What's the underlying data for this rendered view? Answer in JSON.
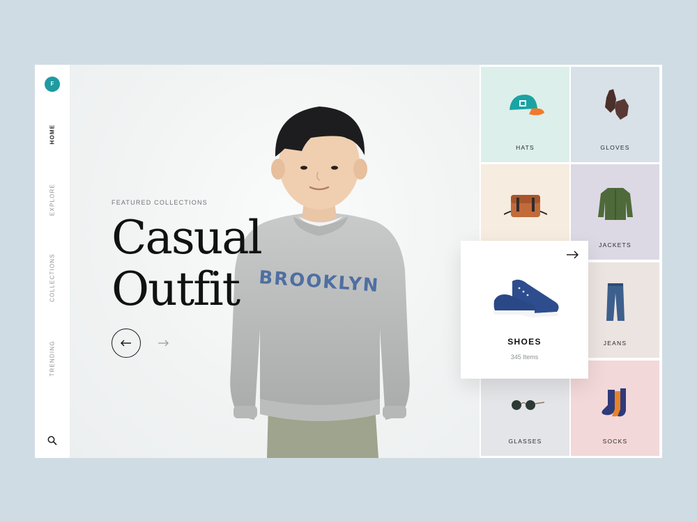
{
  "sidebar": {
    "logo_letter": "F",
    "nav": [
      {
        "label": "HOME",
        "active": true
      },
      {
        "label": "EXPLORE",
        "active": false
      },
      {
        "label": "COLLECTIONS",
        "active": false
      },
      {
        "label": "TRENDING",
        "active": false
      }
    ],
    "search_icon": "search-icon"
  },
  "hero": {
    "eyebrow": "FEATURED COLLECTIONS",
    "headline_line1": "Casual",
    "headline_line2": "Outfit",
    "shirt_text": "BROOKLYN",
    "prev_icon": "arrow-left-icon",
    "next_icon": "arrow-right-icon"
  },
  "categories": [
    {
      "label": "HATS",
      "bg": "#dcefea",
      "icon": "cap-icon"
    },
    {
      "label": "GLOVES",
      "bg": "#d8e1e8",
      "icon": "gloves-icon"
    },
    {
      "label": "",
      "bg": "#f6ecdf",
      "icon": "bag-icon"
    },
    {
      "label": "JACKETS",
      "bg": "#dcd9e5",
      "icon": "jacket-icon"
    },
    {
      "label": "",
      "bg": "#f2f3f3",
      "icon": ""
    },
    {
      "label": "JEANS",
      "bg": "#ece4e0",
      "icon": "jeans-icon"
    },
    {
      "label": "GLASSES",
      "bg": "#e4e5e8",
      "icon": "sunglasses-icon"
    },
    {
      "label": "SOCKS",
      "bg": "#f3d8d9",
      "icon": "socks-icon"
    }
  ],
  "featured": {
    "title": "SHOES",
    "count": "345 Items",
    "icon": "sneaker-icon"
  },
  "colors": {
    "accent": "#1f9aa0",
    "page_bg": "#d0dce3"
  }
}
